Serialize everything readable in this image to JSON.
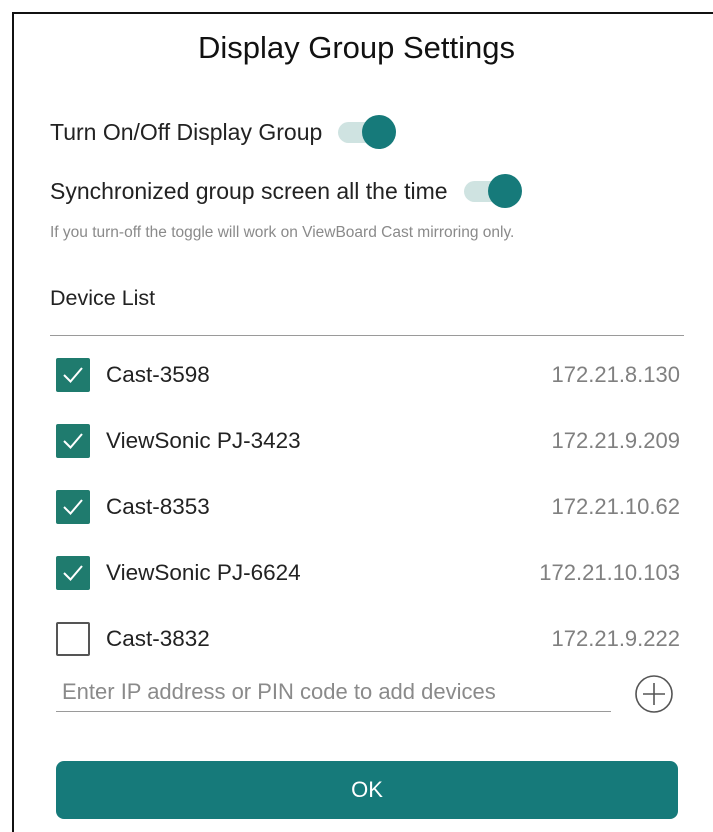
{
  "dialog": {
    "title": "Display Group Settings"
  },
  "settings": {
    "display_group_toggle": {
      "label": "Turn On/Off Display Group",
      "on": true
    },
    "sync_toggle": {
      "label": "Synchronized group screen all the time",
      "on": true
    },
    "note": "If you turn-off the toggle will work on ViewBoard Cast mirroring only."
  },
  "device_list": {
    "label": "Device List",
    "devices": [
      {
        "name": "Cast-3598",
        "ip": "172.21.8.130",
        "checked": true
      },
      {
        "name": "ViewSonic PJ-3423",
        "ip": "172.21.9.209",
        "checked": true
      },
      {
        "name": "Cast-8353",
        "ip": "172.21.10.62",
        "checked": true
      },
      {
        "name": "ViewSonic PJ-6624",
        "ip": "172.21.10.103",
        "checked": true
      },
      {
        "name": "Cast-3832",
        "ip": "172.21.9.222",
        "checked": false
      }
    ]
  },
  "add_device": {
    "placeholder": "Enter IP address or PIN code to add devices",
    "value": "",
    "icon": "plus-circle-icon"
  },
  "ok_button": {
    "label": "OK"
  },
  "colors": {
    "accent": "#167a7a",
    "toggle_track": "#cfe3e1",
    "checkbox": "#1f7b6e"
  }
}
